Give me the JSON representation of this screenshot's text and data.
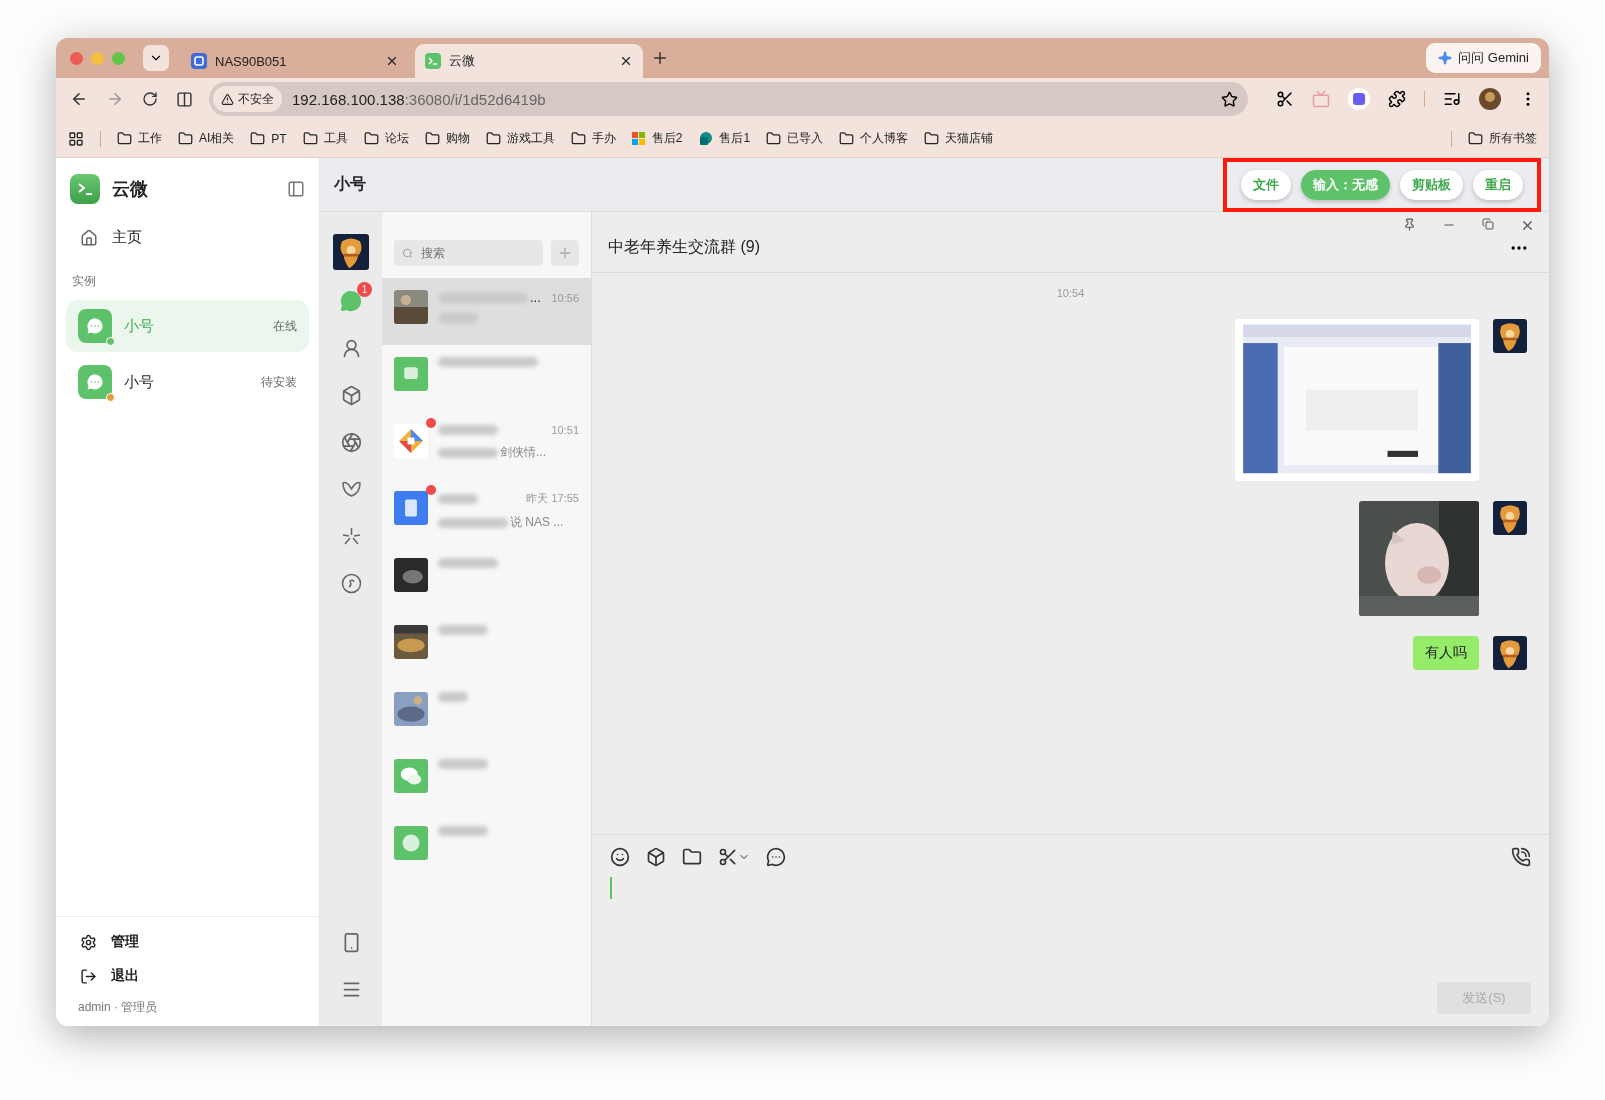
{
  "browser": {
    "tabs": [
      {
        "title": "NAS90B051",
        "selected": false
      },
      {
        "title": "云微",
        "selected": true
      }
    ],
    "gemini": "问问 Gemini",
    "address": {
      "security": "不安全",
      "host": "192.168.100.138",
      "path": ":36080/i/1d52d6419b"
    },
    "bookmarks": [
      {
        "label": "工作",
        "kind": "folder"
      },
      {
        "label": "AI相关",
        "kind": "folder"
      },
      {
        "label": "PT",
        "kind": "folder"
      },
      {
        "label": "工具",
        "kind": "folder"
      },
      {
        "label": "论坛",
        "kind": "folder"
      },
      {
        "label": "购物",
        "kind": "folder"
      },
      {
        "label": "游戏工具",
        "kind": "folder"
      },
      {
        "label": "手办",
        "kind": "folder"
      },
      {
        "label": "售后2",
        "kind": "tiles"
      },
      {
        "label": "售后1",
        "kind": "site"
      },
      {
        "label": "已导入",
        "kind": "folder"
      },
      {
        "label": "个人博客",
        "kind": "folder"
      },
      {
        "label": "天猫店铺",
        "kind": "folder"
      }
    ],
    "all_bookmarks": "所有书签"
  },
  "sidebar": {
    "brand": "云微",
    "nav": [
      {
        "label": "主页"
      }
    ],
    "section": "实例",
    "instances": [
      {
        "name": "小号",
        "status": "在线",
        "selected": true,
        "color": "#5ec26a"
      },
      {
        "name": "小号",
        "status": "待安装",
        "selected": false,
        "color": "#e0a040"
      }
    ],
    "footer": [
      {
        "label": "管理",
        "kind": "settings"
      },
      {
        "label": "退出",
        "kind": "logout"
      }
    ],
    "user": "admin · 管理员"
  },
  "header": {
    "title": "小号",
    "actions": [
      {
        "label": "文件",
        "selected": false
      },
      {
        "label": "输入：无感",
        "selected": true
      },
      {
        "label": "剪贴板",
        "selected": false
      },
      {
        "label": "重启",
        "selected": false
      }
    ]
  },
  "rail": {
    "badge": "1"
  },
  "chat_list": {
    "placeholder": "搜索",
    "items": [
      {
        "suffix": "...",
        "time": "10:56",
        "selected": true,
        "unread": false
      },
      {
        "selected": false,
        "unread": false
      },
      {
        "time": "10:51",
        "preview": "剑侠情...",
        "selected": false,
        "unread": true
      },
      {
        "time": "昨天 17:55",
        "preview": "说 NAS ...",
        "selected": false,
        "unread": true
      },
      {
        "selected": false,
        "unread": false
      },
      {
        "selected": false,
        "unread": false
      },
      {
        "selected": false,
        "unread": false
      },
      {
        "selected": false,
        "unread": false
      },
      {
        "selected": false,
        "unread": false
      }
    ]
  },
  "chat": {
    "title": "中老年养生交流群 (9)",
    "timestamp": "10:54",
    "messages": [
      {
        "kind": "screenshot"
      },
      {
        "kind": "picture"
      },
      {
        "kind": "text",
        "text": "有人吗"
      }
    ],
    "send": "发送(S)"
  }
}
